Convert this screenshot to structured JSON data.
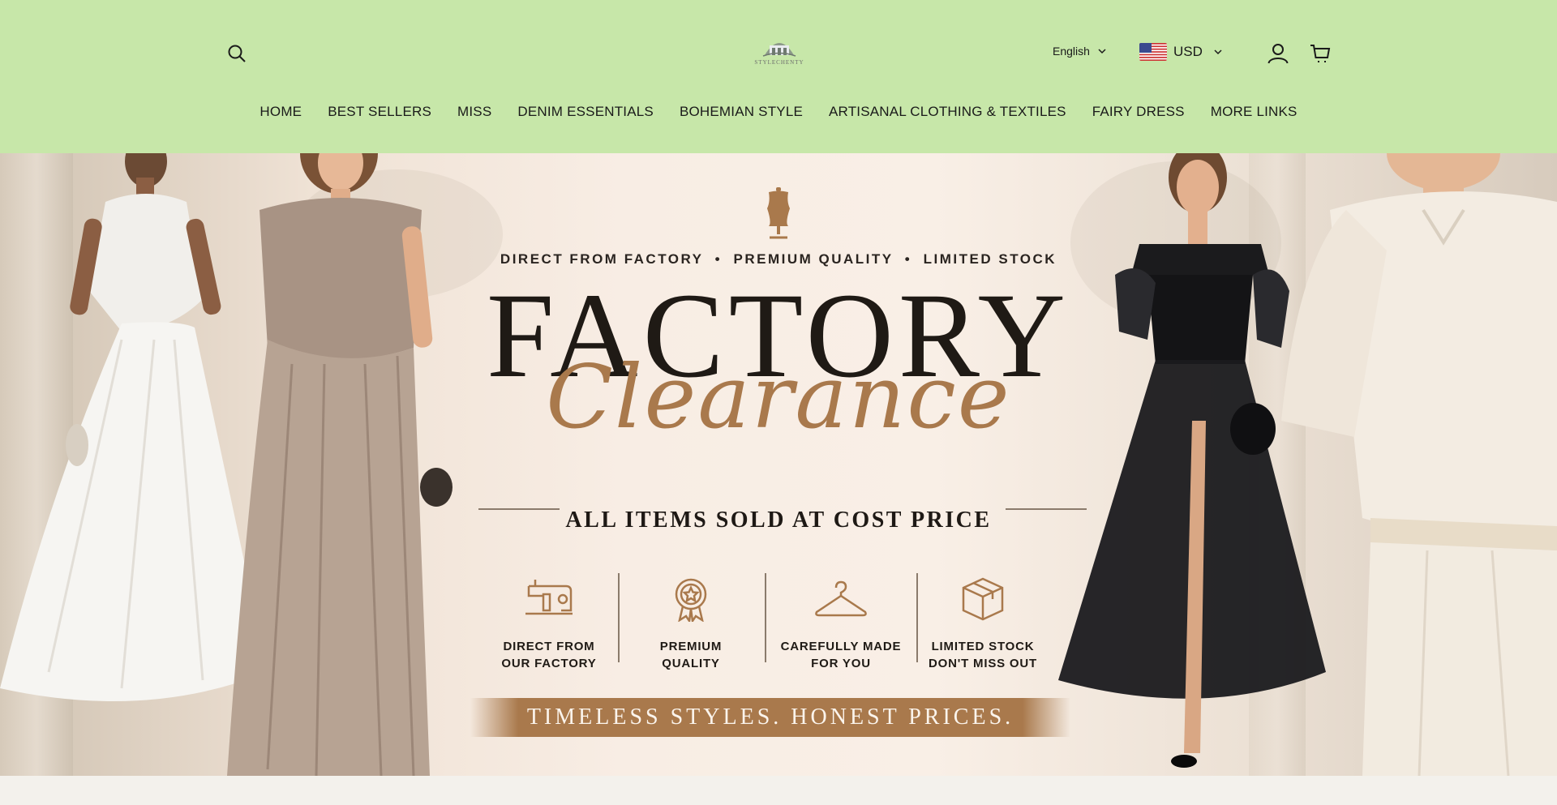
{
  "header": {
    "logo_text": "STYLECHENTY",
    "language": "English",
    "currency": "USD"
  },
  "nav": {
    "items": [
      "HOME",
      "BEST SELLERS",
      "MISS",
      "DENIM ESSENTIALS",
      "BOHEMIAN STYLE",
      "ARTISANAL CLOTHING & TEXTILES",
      "FAIRY DRESS",
      "MORE LINKS"
    ]
  },
  "hero": {
    "tagline": "DIRECT FROM FACTORY  •  PREMIUM QUALITY  •  LIMITED STOCK",
    "title": "FACTORY",
    "script_title": "Clearance",
    "subtitle": "ALL ITEMS SOLD AT COST PRICE",
    "features": [
      {
        "line1": "DIRECT FROM",
        "line2": "OUR FACTORY",
        "icon": "sewing-machine-icon"
      },
      {
        "line1": "PREMIUM",
        "line2": "QUALITY",
        "icon": "award-badge-icon"
      },
      {
        "line1": "CAREFULLY MADE",
        "line2": "FOR YOU",
        "icon": "hanger-icon"
      },
      {
        "line1": "LIMITED STOCK",
        "line2": "DON'T MISS OUT",
        "icon": "box-icon"
      }
    ],
    "banner": "TIMELESS STYLES. HONEST PRICES."
  },
  "colors": {
    "header_bg": "#c7e7a9",
    "accent_brown": "#a9794c",
    "text_dark": "#1f1a15"
  }
}
